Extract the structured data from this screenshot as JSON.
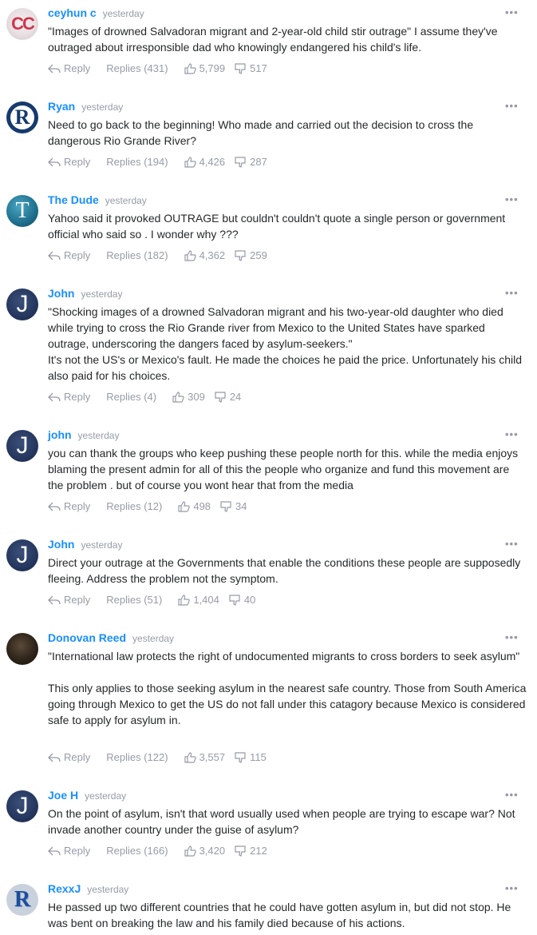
{
  "comments": [
    {
      "author": "ceyhun c",
      "time": "yesterday",
      "avatar": "CC",
      "lines": [
        "\"Images of drowned Salvadoran migrant and 2-year-old child stir outrage\" I assume they've outraged about irresponsible dad who knowingly endangered his child's life."
      ],
      "reply": "Reply",
      "replies": "Replies (431)",
      "likes": "5,799",
      "dislikes": "517"
    },
    {
      "author": "Ryan",
      "time": "yesterday",
      "avatar": "R",
      "lines": [
        "Need to go back to the beginning! Who made and carried out the decision to cross the dangerous Rio Grande River?"
      ],
      "reply": "Reply",
      "replies": "Replies (194)",
      "likes": "4,426",
      "dislikes": "287"
    },
    {
      "author": "The Dude",
      "time": "yesterday",
      "avatar": "T",
      "lines": [
        "Yahoo said it provoked OUTRAGE but couldn't couldn't quote a single person or government official who said so . I wonder why ???"
      ],
      "reply": "Reply",
      "replies": "Replies (182)",
      "likes": "4,362",
      "dislikes": "259"
    },
    {
      "author": "John",
      "time": "yesterday",
      "avatar": "J",
      "lines": [
        "\"Shocking images of a drowned Salvadoran migrant and his two-year-old daughter who died while trying to cross the Rio Grande river from Mexico to the United States have sparked outrage, underscoring the dangers faced by asylum-seekers.\"",
        "It's not the US's or Mexico's fault. He made the choices he paid the price. Unfortunately his child also paid for his choices."
      ],
      "reply": "Reply",
      "replies": "Replies (4)",
      "likes": "309",
      "dislikes": "24"
    },
    {
      "author": "john",
      "time": "yesterday",
      "avatar": "J",
      "lines": [
        "you can thank the groups who keep pushing these people north for this. while the media enjoys blaming the present admin for all of this the people who organize and fund this movement are the problem . but of course you wont hear that from the media"
      ],
      "reply": "Reply",
      "replies": "Replies (12)",
      "likes": "498",
      "dislikes": "34"
    },
    {
      "author": "John",
      "time": "yesterday",
      "avatar": "J",
      "lines": [
        "Direct your outrage at the Governments that enable the conditions these people are supposedly fleeing. Address the problem not the symptom."
      ],
      "reply": "Reply",
      "replies": "Replies (51)",
      "likes": "1,404",
      "dislikes": "40"
    },
    {
      "author": "Donovan Reed",
      "time": "yesterday",
      "avatar": "",
      "lines": [
        "\"International law protects the right of undocumented migrants to cross borders to seek asylum\"",
        "This only applies to those seeking asylum in the nearest safe country. Those from South America going through Mexico to get the US do not fall under this catagory because Mexico is considered safe to apply for asylum in."
      ],
      "reply": "Reply",
      "replies": "Replies (122)",
      "likes": "3,557",
      "dislikes": "115"
    },
    {
      "author": "Joe H",
      "time": "yesterday",
      "avatar": "J",
      "lines": [
        "On the point of asylum, isn't that word usually used when people are trying to escape war? Not invade another country under the guise of asylum?"
      ],
      "reply": "Reply",
      "replies": "Replies (166)",
      "likes": "3,420",
      "dislikes": "212"
    },
    {
      "author": "RexxJ",
      "time": "yesterday",
      "avatar": "R",
      "lines": [
        "He passed up two different countries that he could have gotten asylum in, but did not stop. He was bent on breaking the law and his family died because of his actions."
      ],
      "reply": "",
      "replies": "",
      "likes": "",
      "dislikes": ""
    }
  ],
  "more_label": "•••",
  "colors": {
    "author": "#188fff",
    "meta": "#979ba7",
    "text": "#26282a"
  },
  "icons": {
    "reply": "reply-arrow-icon",
    "like": "thumbs-up-icon",
    "dislike": "thumbs-down-icon",
    "more": "more-options-icon"
  }
}
